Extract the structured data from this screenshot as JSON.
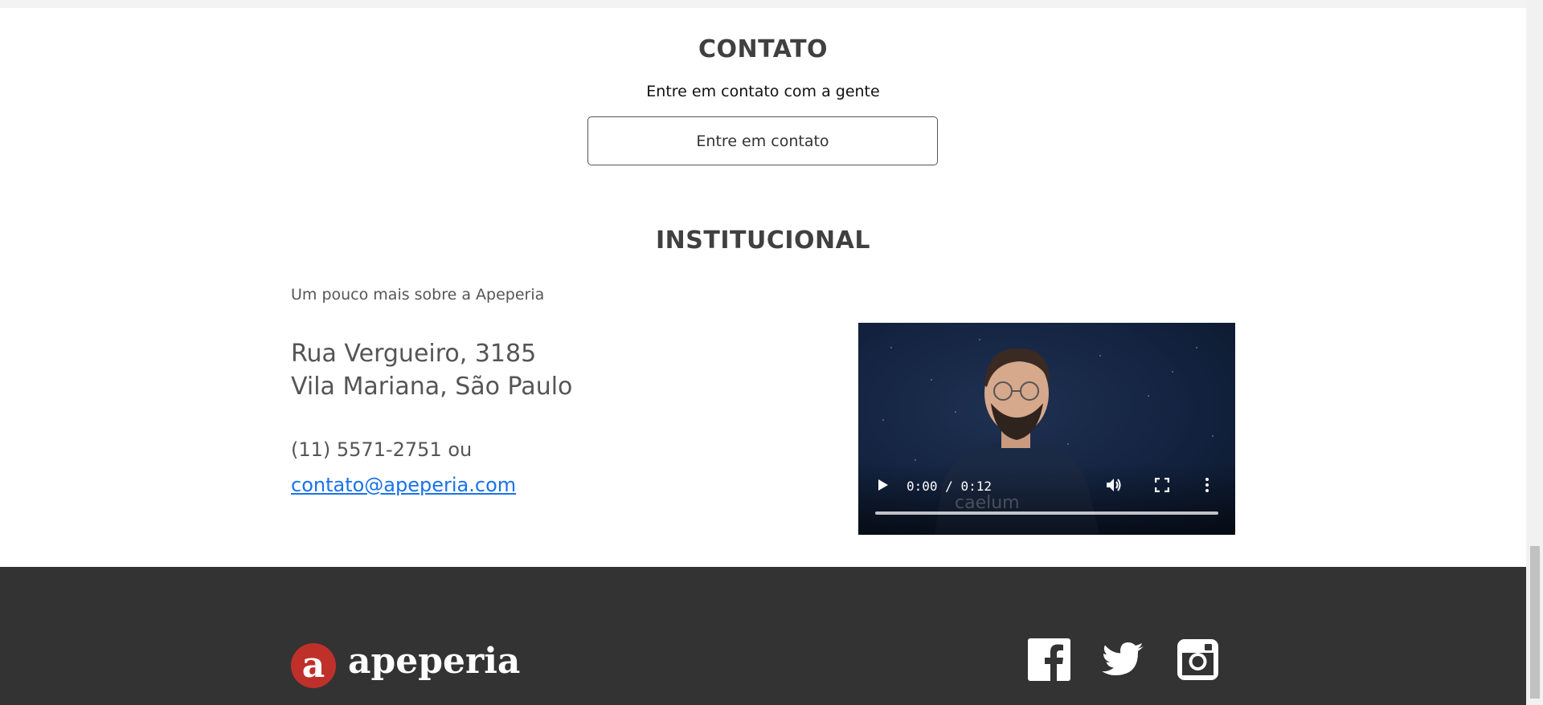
{
  "contact": {
    "title": "CONTATO",
    "subtitle": "Entre em contato com a gente",
    "button_label": "Entre em contato"
  },
  "institutional": {
    "title": "INSTITUCIONAL",
    "subtitle": "Um pouco mais sobre a Apeperia",
    "address_line1": "Rua Vergueiro, 3185",
    "address_line2": "Vila Mariana, São Paulo",
    "phone": "(11) 5571-2751 ou",
    "email": "contato@apeperia.com"
  },
  "video": {
    "current_time": "0:00",
    "separator": " / ",
    "duration": "0:12",
    "watermark": "caelum",
    "progress": 0
  },
  "footer": {
    "logo_letter": "a",
    "brand_name": "apeperia",
    "social": [
      {
        "name": "facebook-icon"
      },
      {
        "name": "twitter-icon"
      },
      {
        "name": "instagram-icon"
      }
    ]
  },
  "colors": {
    "footer_bg": "#333333",
    "logo_red": "#c0302b",
    "link_blue": "#1a73e8",
    "heading": "#404040"
  }
}
